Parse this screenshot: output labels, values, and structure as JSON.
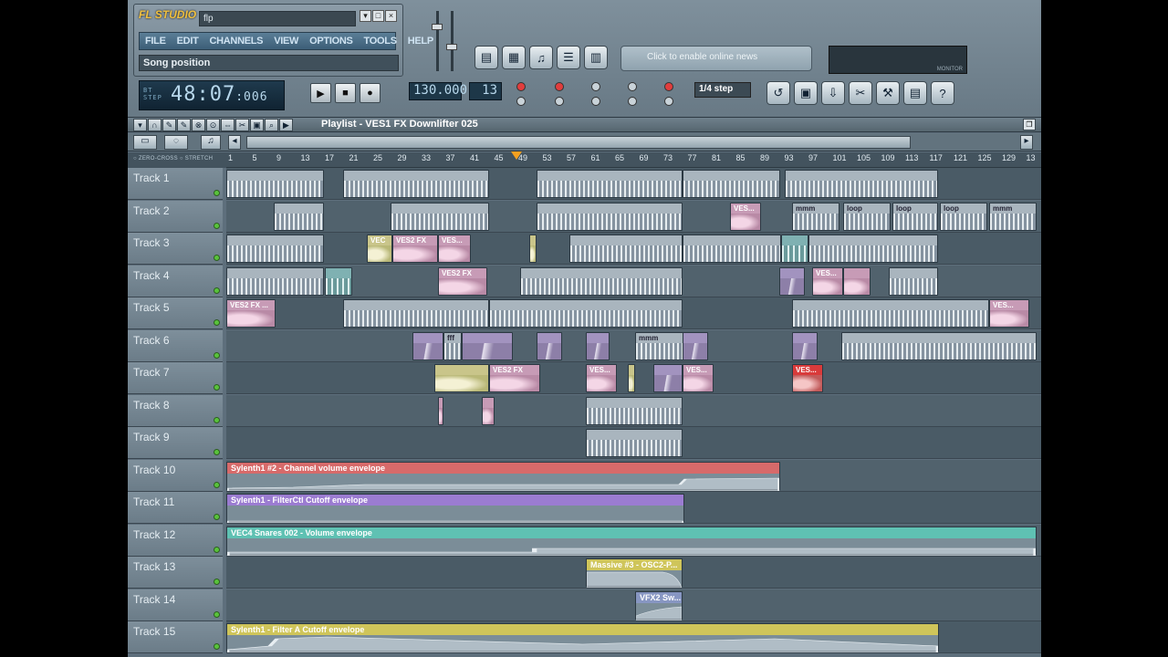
{
  "app": {
    "logo": "FL STUDIO",
    "file": "flp",
    "hint": "Song position"
  },
  "menu": [
    "FILE",
    "EDIT",
    "CHANNELS",
    "VIEW",
    "OPTIONS",
    "TOOLS",
    "HELP"
  ],
  "window_buttons": [
    "▾",
    "□",
    "×"
  ],
  "time": {
    "main": "48:07",
    "sub": ":006",
    "label_top": "BT",
    "label_bot": "STEP"
  },
  "tempo": "130.000",
  "pattern": "13",
  "step": "1/4 step",
  "news": "Click to enable online news",
  "monitor_label": "MONITOR",
  "playlist": {
    "title": "Playlist - VES1 FX Downlifter 025",
    "zero_cross": "ZERO-CROSS",
    "stretch": "STRETCH"
  },
  "ruler": [
    "1",
    "5",
    "9",
    "13",
    "17",
    "21",
    "25",
    "29",
    "33",
    "37",
    "41",
    "45",
    "49",
    "53",
    "57",
    "61",
    "65",
    "69",
    "73",
    "77",
    "81",
    "85",
    "89",
    "93",
    "97",
    "101",
    "105",
    "109",
    "113",
    "117",
    "121",
    "125",
    "129",
    "13"
  ],
  "tracks": [
    {
      "name": "Track 1"
    },
    {
      "name": "Track 2"
    },
    {
      "name": "Track 3"
    },
    {
      "name": "Track 4"
    },
    {
      "name": "Track 5"
    },
    {
      "name": "Track 6"
    },
    {
      "name": "Track 7"
    },
    {
      "name": "Track 8"
    },
    {
      "name": "Track 9"
    },
    {
      "name": "Track 10"
    },
    {
      "name": "Track 11"
    },
    {
      "name": "Track 12"
    },
    {
      "name": "Track 13"
    },
    {
      "name": "Track 14"
    },
    {
      "name": "Track 15"
    }
  ],
  "clip_labels": {
    "ves_fx": "VES2 FX ...",
    "vec": "VEC",
    "ves2fx": "VES2 FX",
    "ves": "VES...",
    "loop": "loop",
    "mmm": "mmm",
    "fff": "fff",
    "env10": "Sylenth1 #2 - Channel volume envelope",
    "env11": "Sylenth1 - FilterCtl Cutoff envelope",
    "env12": "VEC4 Snares 002 - Volume envelope",
    "env13": "Massive #3 - OSC2-P...",
    "env14": "VFX2 Sw...",
    "env15": "Sylenth1 - Filter A Cutoff envelope"
  }
}
